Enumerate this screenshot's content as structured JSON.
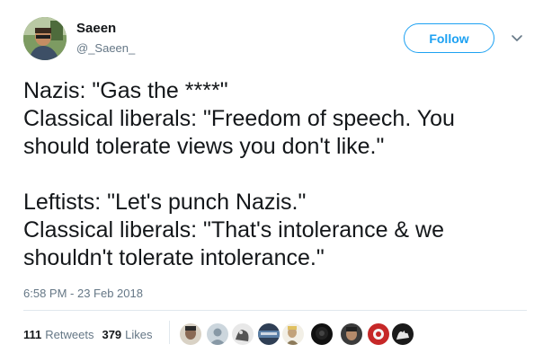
{
  "author": {
    "name": "Saeen",
    "handle": "@_Saeen_",
    "follow_label": "Follow"
  },
  "tweet": {
    "lines": [
      "Nazis: \"Gas the ****\"",
      "Classical liberals: \"Freedom of speech. You",
      "should tolerate views you don't like.\"",
      "",
      "Leftists: \"Let's punch Nazis.\"",
      "Classical liberals: \"That's intolerance & we",
      "shouldn't tolerate intolerance.\""
    ],
    "timestamp": "6:58 PM - 23 Feb 2018"
  },
  "stats": {
    "retweets_count": "111",
    "retweets_label": "Retweets",
    "likes_count": "379",
    "likes_label": "Likes"
  },
  "icons": {
    "chevron": "chevron-down-icon"
  },
  "colors": {
    "accent": "#1da1f2",
    "secondary_text": "#657786",
    "primary_text": "#14171a",
    "divider": "#e1e8ed"
  }
}
